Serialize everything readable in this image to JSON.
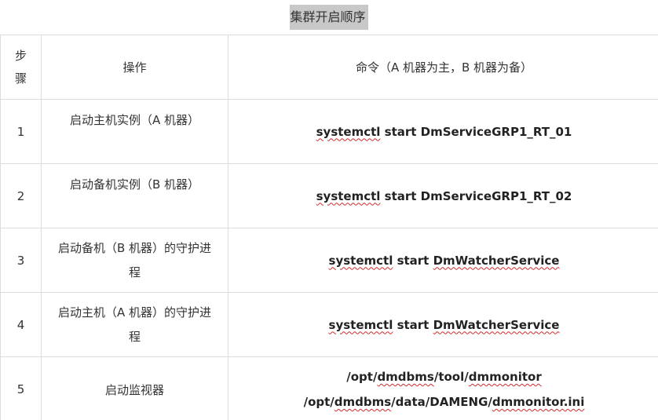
{
  "title": "集群开启顺序",
  "header": {
    "step": "步骤",
    "operation": "操作",
    "command": "命令（A 机器为主，B 机器为备）"
  },
  "rows": [
    {
      "step": "1",
      "operation": "启动主机实例（A 机器）",
      "command_squiggle": "systemctl",
      "command_rest": " start DmServiceGRP1_RT_01"
    },
    {
      "step": "2",
      "operation": "启动备机实例（B 机器）",
      "command_squiggle": "systemctl",
      "command_rest": " start DmServiceGRP1_RT_02"
    },
    {
      "step": "3",
      "operation": "启动备机（B 机器）的守护进程",
      "command_squiggle": "systemctl",
      "command_mid": " start ",
      "command_squiggle2": "DmWatcherService"
    },
    {
      "step": "4",
      "operation": "启动主机（A 机器）的守护进程",
      "command_squiggle": "systemctl",
      "command_mid": " start ",
      "command_squiggle2": "DmWatcherService"
    },
    {
      "step": "5",
      "operation": "启动监视器",
      "command_line1_a": "/opt/",
      "command_line1_b": "dmdbms",
      "command_line1_c": "/tool/",
      "command_line1_d": "dmmonitor",
      "command_line2_a": "/opt/",
      "command_line2_b": "dmdbms",
      "command_line2_c": "/data/DAMENG/",
      "command_line2_d": "dmmonitor.ini"
    }
  ]
}
